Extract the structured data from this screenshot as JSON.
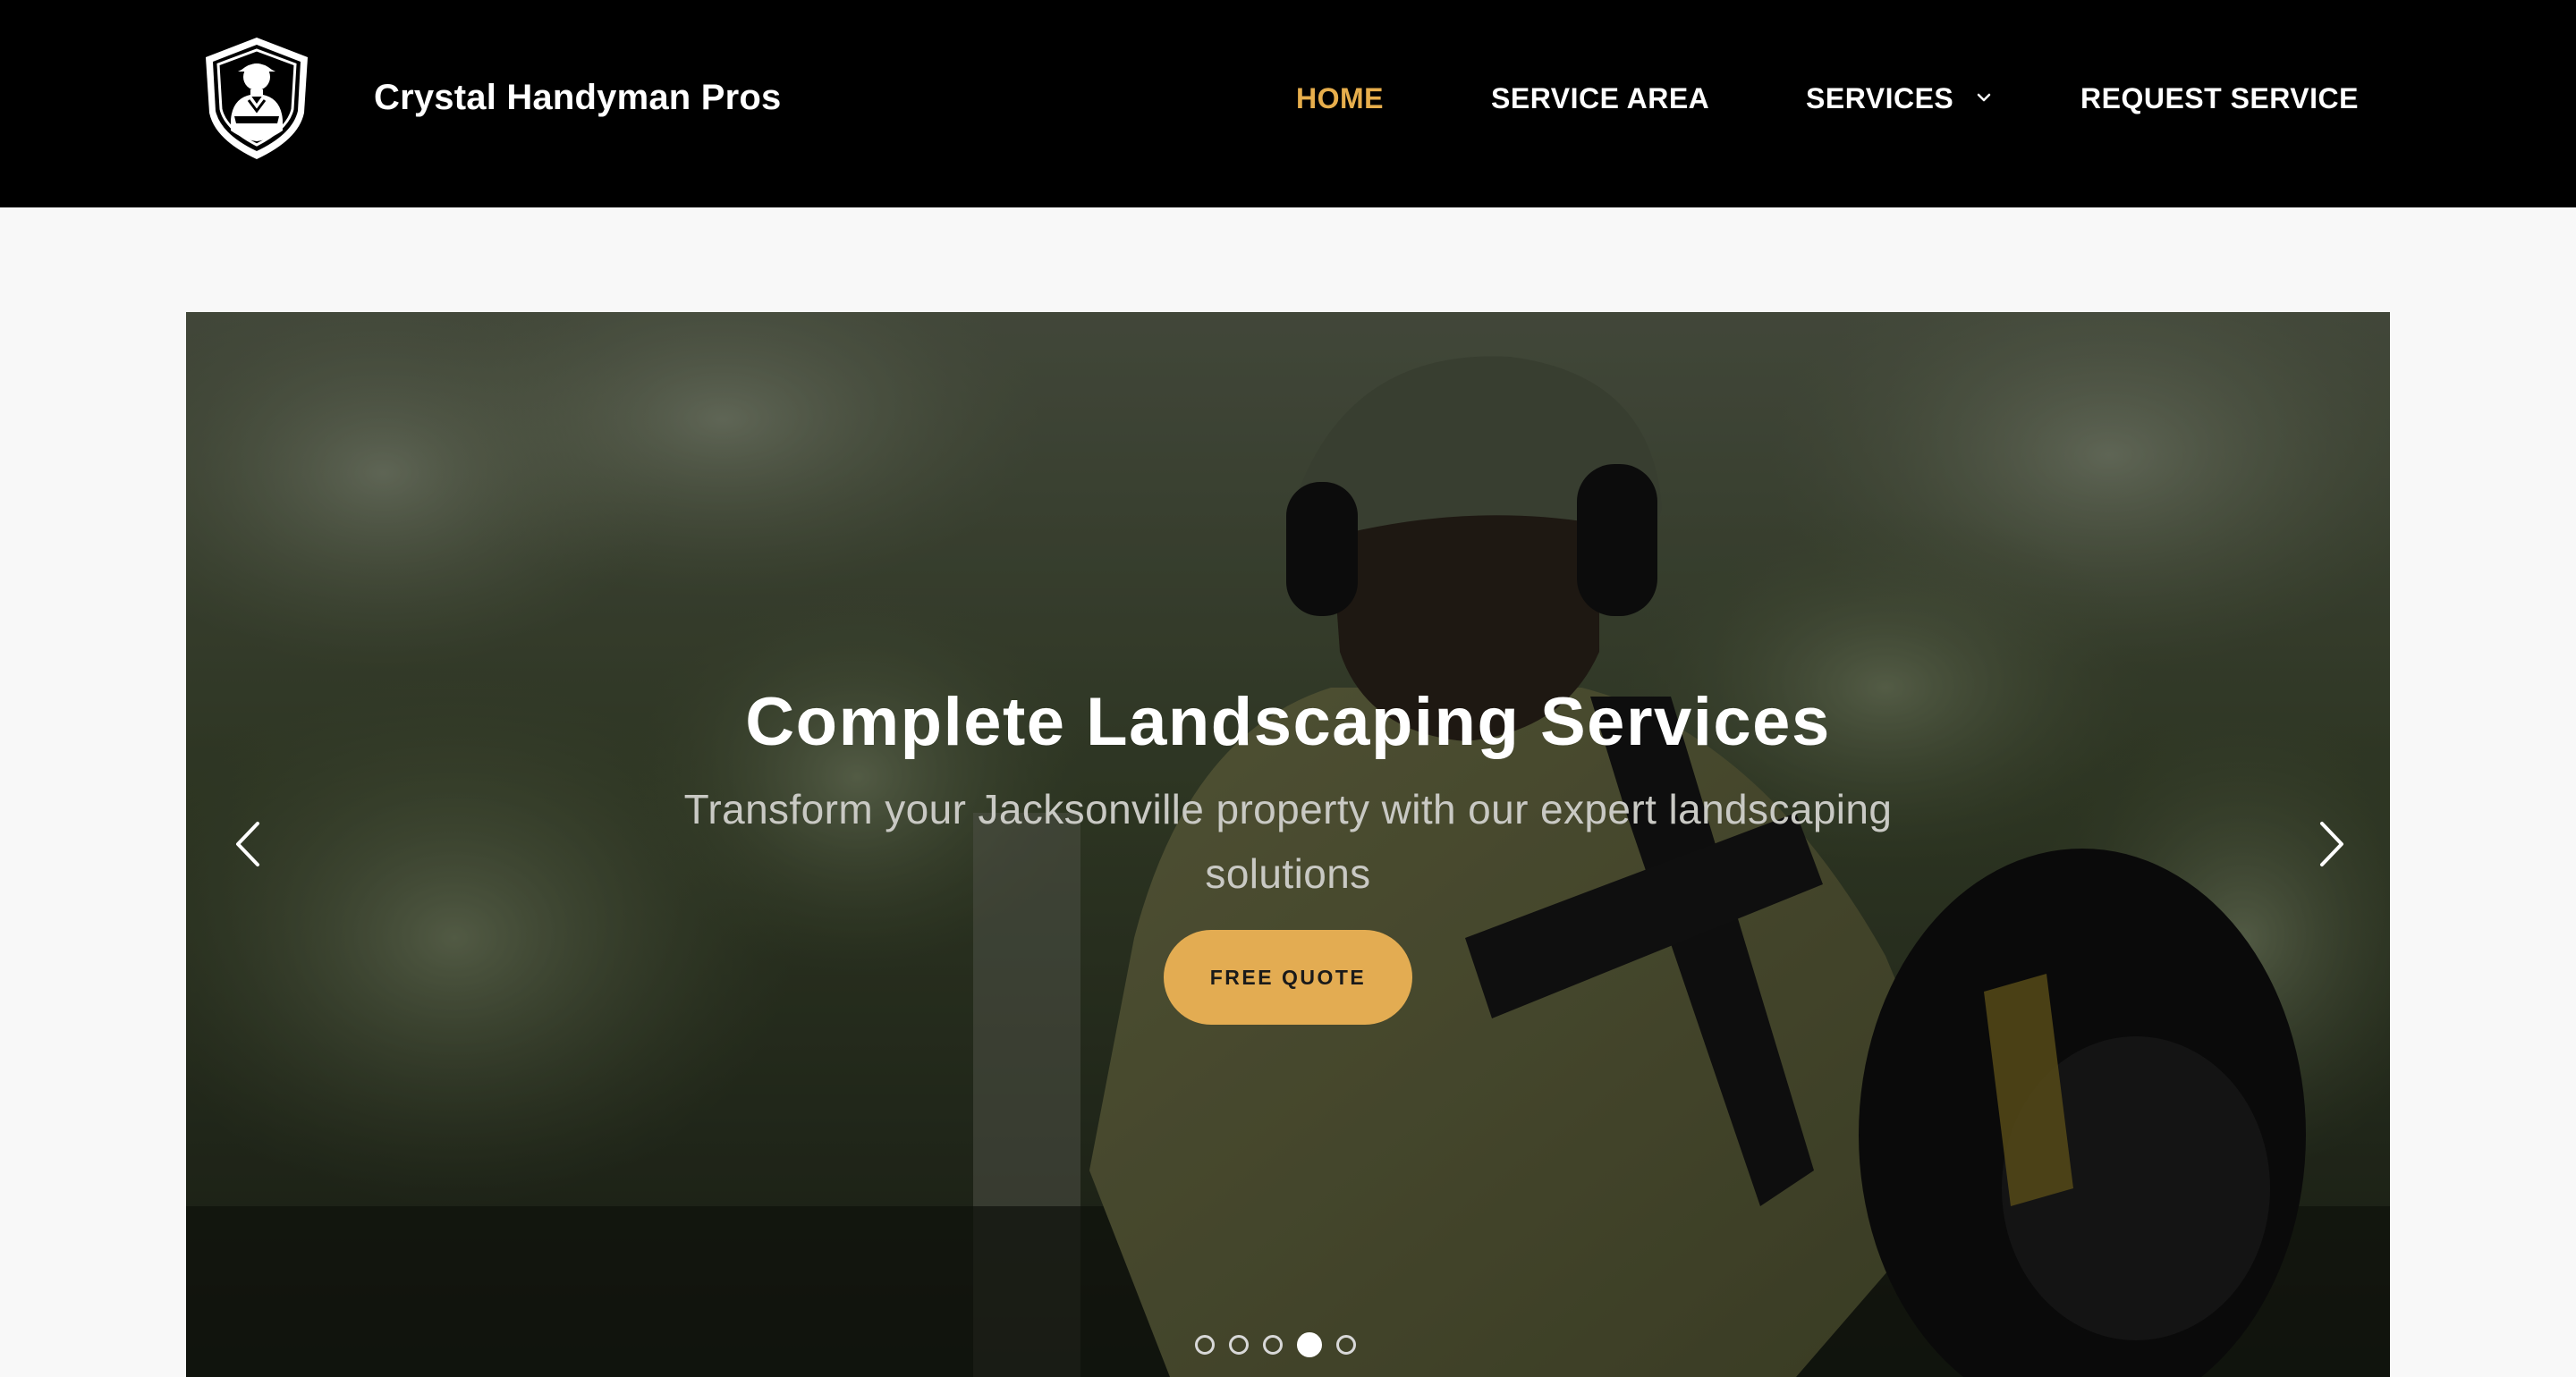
{
  "header": {
    "brand_name": "Crystal Handyman Pros",
    "logo_icon": "handyman-shield-logo-icon"
  },
  "nav": {
    "home": "HOME",
    "service_area": "SERVICE AREA",
    "services": "SERVICES",
    "services_icon": "chevron-down-icon",
    "request_service": "REQUEST SERVICE",
    "active_item": "HOME"
  },
  "hero": {
    "title": "Complete Landscaping Services",
    "subtitle": "Transform your Jacksonville property with our expert landscaping solutions",
    "cta_label": "FREE QUOTE",
    "prev_icon": "chevron-left-icon",
    "next_icon": "chevron-right-icon",
    "slide_count": 5,
    "active_slide": 4
  },
  "colors": {
    "header_bg": "#000000",
    "accent": "#e7ae4c",
    "cta_bg": "#e3ac52",
    "page_bg": "#f8f8f8"
  }
}
